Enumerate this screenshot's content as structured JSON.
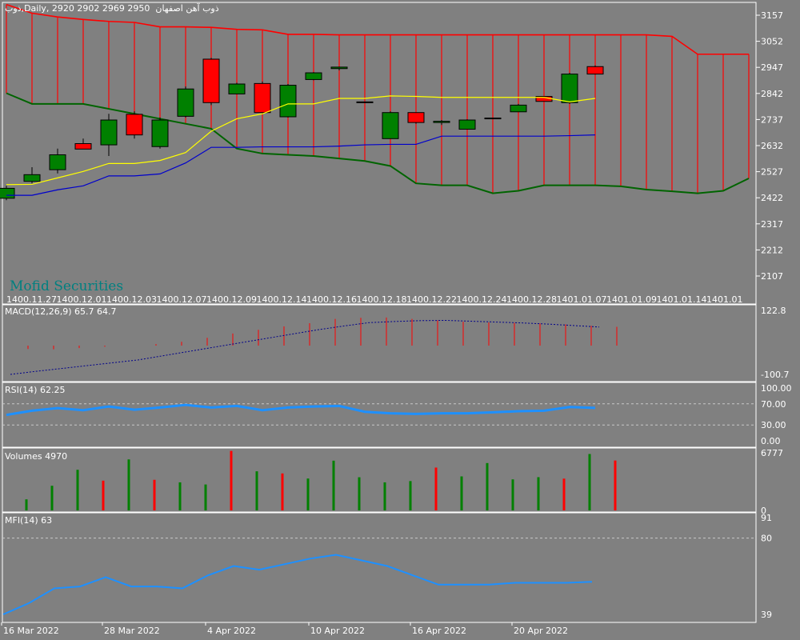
{
  "header": {
    "symbol": "ذوب",
    "timeframe": "Daily",
    "ohlc": "2920 2902 2969 2950",
    "name": "ذوب آهن اصفهان"
  },
  "watermark": "Mofid Securities",
  "colors": {
    "background": "#808080",
    "bull": "#008000",
    "bear": "#ff0000",
    "tenkan": "#ffff00",
    "kijun": "#0000cc",
    "cloud_top": "#ff0000",
    "cloud_bottom": "#006400",
    "rsi": "#1e90ff",
    "mfi": "#1e90ff",
    "grid_text": "#ffffff"
  },
  "panels": {
    "main": {
      "y_ticks": [
        "3157",
        "3052",
        "2947",
        "2842",
        "2737",
        "2632",
        "2527",
        "2422",
        "2317",
        "2212",
        "2107"
      ]
    },
    "macd": {
      "label": "MACD(12,26,9) 65.7 64.7",
      "y_ticks": [
        "122.8",
        "-100.7"
      ]
    },
    "rsi": {
      "label": "RSI(14) 62.25",
      "y_ticks": [
        "100.00",
        "70.00",
        "30.00",
        "0.00"
      ]
    },
    "volumes": {
      "label": "Volumes 4970",
      "y_ticks": [
        "6777",
        "0"
      ]
    },
    "mfi": {
      "label": "MFI(14) 63",
      "y_ticks": [
        "91",
        "80",
        "39"
      ]
    }
  },
  "x_axis": {
    "dates": [
      "16 Mar 2022",
      "28 Mar 2022",
      "4 Apr 2022",
      "10 Apr 2022",
      "16 Apr 2022",
      "20 Apr 2022"
    ]
  },
  "separator_dates": [
    "1400.11.27",
    "1400.12.01",
    "1400.12.03",
    "1400.12.07",
    "1400.12.09",
    "1400.12.14",
    "1400.12.16",
    "1400.12.18",
    "1400.12.22",
    "1400.12.24",
    "1400.12.28",
    "1401.01.07",
    "1401.01.09",
    "1401.01.14",
    "1401.01"
  ],
  "chart_data": {
    "type": "candlestick",
    "price_ylim": [
      2107,
      3157
    ],
    "candles": [
      {
        "o": 2420,
        "h": 2470,
        "l": 2412,
        "c": 2460
      },
      {
        "o": 2488,
        "h": 2545,
        "l": 2480,
        "c": 2515
      },
      {
        "o": 2535,
        "h": 2620,
        "l": 2520,
        "c": 2595
      },
      {
        "o": 2640,
        "h": 2660,
        "l": 2620,
        "c": 2618
      },
      {
        "o": 2635,
        "h": 2760,
        "l": 2590,
        "c": 2735
      },
      {
        "o": 2758,
        "h": 2770,
        "l": 2660,
        "c": 2675
      },
      {
        "o": 2628,
        "h": 2745,
        "l": 2620,
        "c": 2735
      },
      {
        "o": 2750,
        "h": 2870,
        "l": 2745,
        "c": 2860
      },
      {
        "o": 2980,
        "h": 2985,
        "l": 2795,
        "c": 2805
      },
      {
        "o": 2840,
        "h": 2885,
        "l": 2838,
        "c": 2880
      },
      {
        "o": 2882,
        "h": 2890,
        "l": 2760,
        "c": 2765
      },
      {
        "o": 2748,
        "h": 2880,
        "l": 2745,
        "c": 2875
      },
      {
        "o": 2898,
        "h": 2928,
        "l": 2895,
        "c": 2925
      },
      {
        "o": 2942,
        "h": 2950,
        "l": 2935,
        "c": 2948
      },
      {
        "o": 2808,
        "h": 2808,
        "l": 2808,
        "c": 2808
      },
      {
        "o": 2660,
        "h": 2770,
        "l": 2660,
        "c": 2765
      },
      {
        "o": 2765,
        "h": 2765,
        "l": 2720,
        "c": 2725
      },
      {
        "o": 2725,
        "h": 2735,
        "l": 2715,
        "c": 2730
      },
      {
        "o": 2698,
        "h": 2738,
        "l": 2698,
        "c": 2735
      },
      {
        "o": 2743,
        "h": 2743,
        "l": 2743,
        "c": 2743
      },
      {
        "o": 2768,
        "h": 2800,
        "l": 2768,
        "c": 2795
      },
      {
        "o": 2830,
        "h": 2830,
        "l": 2810,
        "c": 2810
      },
      {
        "o": 2805,
        "h": 2925,
        "l": 2800,
        "c": 2920
      },
      {
        "o": 2950,
        "h": 2955,
        "l": 2918,
        "c": 2920
      }
    ],
    "tenkan": [
      2475,
      2476,
      2502,
      2528,
      2560,
      2560,
      2572,
      2604,
      2690,
      2740,
      2760,
      2800,
      2800,
      2822,
      2822,
      2832,
      2830,
      2826,
      2826,
      2826,
      2826,
      2826,
      2808,
      2822
    ],
    "kijun": [
      2432,
      2432,
      2454,
      2470,
      2510,
      2510,
      2518,
      2562,
      2625,
      2625,
      2627,
      2627,
      2627,
      2630,
      2635,
      2637,
      2637,
      2670,
      2670,
      2670,
      2670,
      2670,
      2672,
      2675
    ],
    "cloud_top": [
      3200,
      3165,
      3150,
      3140,
      3132,
      3128,
      3110,
      3110,
      3108,
      3100,
      3098,
      3080,
      3080,
      3078,
      3078,
      3078,
      3078,
      3078,
      3078,
      3078,
      3078,
      3078,
      3078,
      3078,
      3078,
      3078,
      3072,
      3000,
      3000,
      3000
    ],
    "cloud_bottom": [
      2843,
      2800,
      2800,
      2800,
      2780,
      2760,
      2740,
      2720,
      2700,
      2620,
      2600,
      2595,
      2590,
      2580,
      2570,
      2550,
      2480,
      2472,
      2472,
      2440,
      2450,
      2472,
      2472,
      2472,
      2468,
      2455,
      2448,
      2440,
      2450,
      2500
    ],
    "macd_histogram": [
      -12,
      -13,
      -9,
      -4,
      0,
      5,
      13,
      27,
      42,
      55,
      67,
      78,
      93,
      97,
      98,
      93,
      88,
      83,
      81,
      79,
      77,
      74,
      69,
      65.7
    ],
    "macd_signal": [
      -100.7,
      -90,
      -80,
      -70,
      -60,
      -50,
      -35,
      -20,
      -5,
      10,
      25,
      40,
      55,
      68,
      80,
      84,
      87,
      88,
      85,
      82,
      79,
      75,
      70,
      64.7
    ],
    "rsi": [
      49,
      57,
      62,
      58,
      65,
      59,
      63,
      68,
      63,
      66,
      58,
      63,
      65,
      66,
      55,
      52,
      51,
      52,
      52,
      54,
      56,
      57,
      64,
      62.25
    ],
    "volumes": [
      1300,
      2900,
      4780,
      3500,
      6000,
      3600,
      3300,
      3050,
      7000,
      4600,
      4350,
      3750,
      5850,
      3900,
      3300,
      3450,
      5040,
      4000,
      5570,
      3650,
      3910,
      3740,
      6630,
      5870
    ],
    "mfi": [
      39,
      45,
      53,
      54,
      59,
      54,
      54,
      53,
      60,
      65,
      63,
      66,
      69,
      71,
      68,
      65,
      60,
      55,
      55,
      55,
      56,
      56,
      56,
      56.5
    ],
    "rsi_levels": [
      70,
      30
    ],
    "mfi_level": 80
  }
}
